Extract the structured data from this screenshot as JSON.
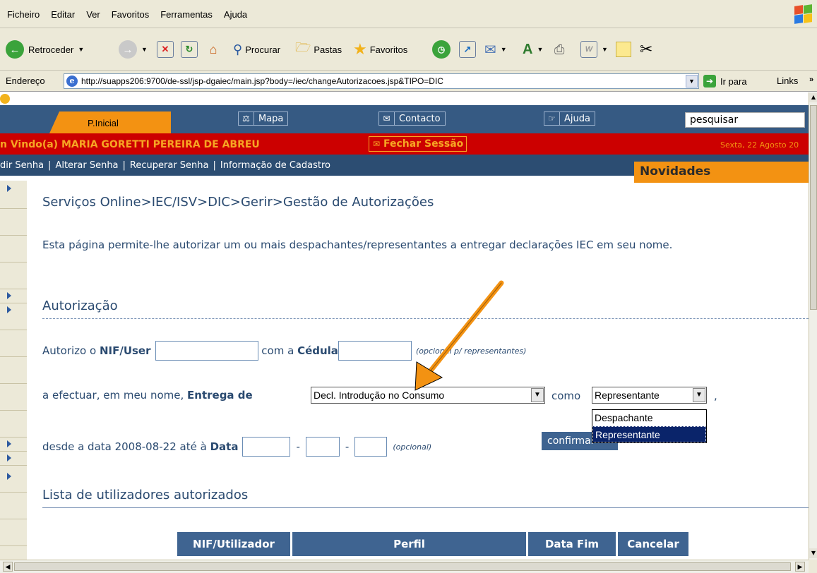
{
  "menu": [
    "Ficheiro",
    "Editar",
    "Ver",
    "Favoritos",
    "Ferramentas",
    "Ajuda"
  ],
  "toolbar": {
    "back": "Retroceder",
    "search": "Procurar",
    "folders": "Pastas",
    "favorites": "Favoritos"
  },
  "address": {
    "label": "Endereço",
    "url": "http://suapps206:9700/de-ssl/jsp-dgaiec/main.jsp?body=/iec/changeAutorizacoes.jsp&TIPO=DIC",
    "go": "Ir para",
    "links": "Links"
  },
  "header": {
    "home_tab": "P.Inicial",
    "nav": [
      "Mapa",
      "Contacto",
      "Ajuda"
    ],
    "search_value": "pesquisar",
    "welcome": "n Vindo(a) MARIA GORETTI PEREIRA DE ABREU",
    "logout": "Fechar Sessão",
    "date": "Sexta, 22 Agosto 20",
    "sublinks": [
      "dir Senha",
      "Alterar Senha",
      "Recuperar Senha",
      "Informação de Cadastro"
    ],
    "news": "Novidades"
  },
  "content": {
    "breadcrumb": "Serviços Online>IEC/ISV>DIC>Gerir>Gestão de Autorizações",
    "intro": "Esta página permite-lhe autorizar um ou mais despachantes/representantes a entregar declarações IEC em seu nome.",
    "section_auth": "Autorização",
    "row1": {
      "prefix": "Autorizo o ",
      "nif_label": "NIF/User",
      "mid": " com a ",
      "cedula_label": "Cédula",
      "note": "(opcional p/ representantes)"
    },
    "row2": {
      "prefix": "a efectuar, em meu nome, ",
      "entrega_label": "Entrega de",
      "decl_value": "Decl. Introdução no Consumo",
      "como": "como",
      "role_value": "Representante",
      "suffix": ","
    },
    "role_options": [
      "Despachante",
      "Representante"
    ],
    "row3": {
      "prefix": "desde a data 2008-08-22 até à ",
      "data_label": "Data",
      "dash": "-",
      "note": "(opcional)"
    },
    "confirm": "confirmar",
    "section_list": "Lista de utilizadores autorizados",
    "table_headers": [
      "NIF/Utilizador",
      "Perfil",
      "Data Fim",
      "Cancelar"
    ]
  },
  "colors": {
    "nav_blue": "#365a83",
    "accent_orange": "#f39212",
    "session_red": "#cc0000",
    "text_blue": "#2a4a70",
    "button_blue": "#3f6491"
  }
}
